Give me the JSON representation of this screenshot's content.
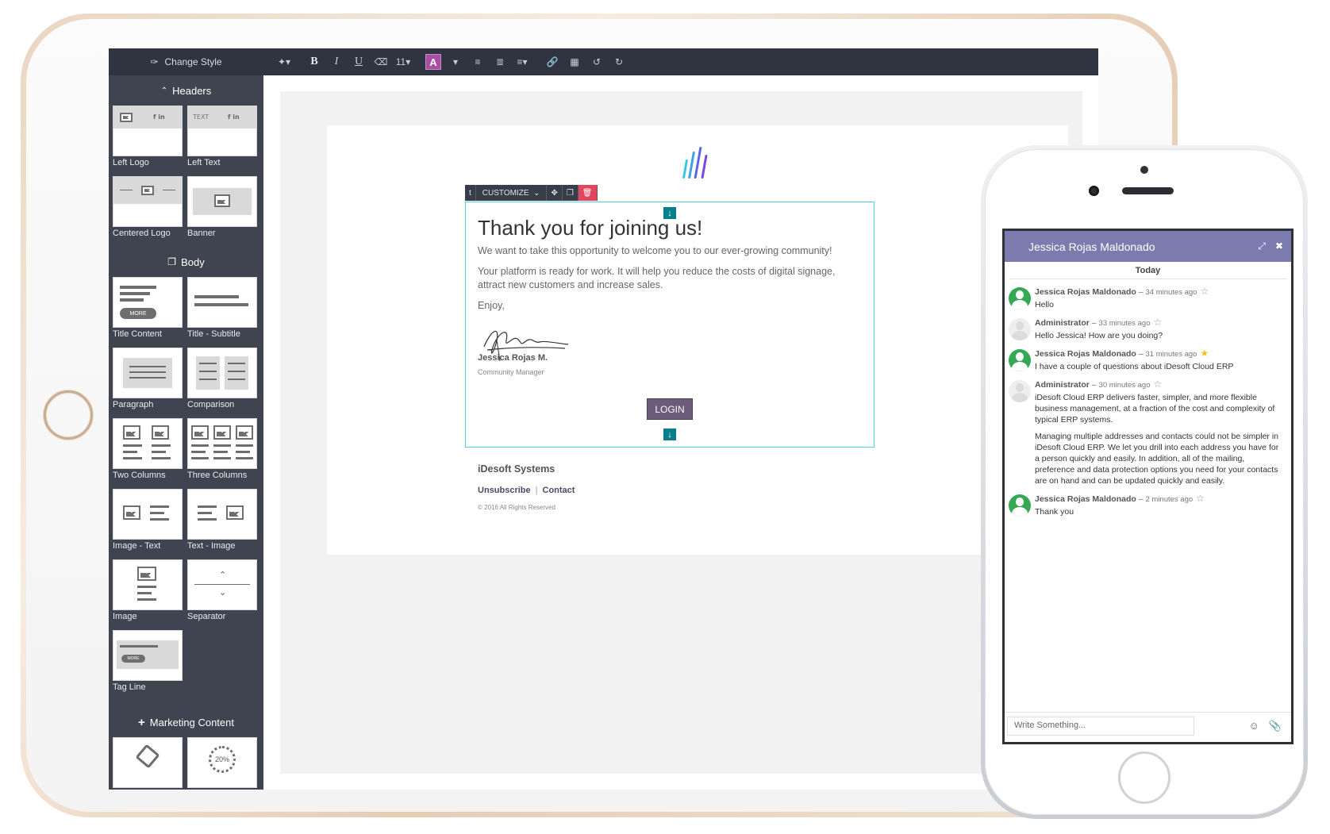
{
  "editor": {
    "change_style": "Change Style",
    "sections": {
      "headers": "Headers",
      "body": "Body",
      "marketing": "Marketing Content"
    },
    "header_tiles": [
      "Left Logo",
      "Left Text",
      "Centered Logo",
      "Banner"
    ],
    "body_tiles": [
      "Title Content",
      "Title - Subtitle",
      "Paragraph",
      "Comparison",
      "Two Columns",
      "Three Columns",
      "Image - Text",
      "Text - Image",
      "Image",
      "Separator",
      "Tag Line"
    ],
    "tile_text": {
      "text": "TEXT",
      "social": "f in ",
      "more": "MORE",
      "percent": "20%"
    },
    "toolbar": {
      "font_size": "11",
      "color_letter": "A"
    }
  },
  "email": {
    "customize_label": "CUSTOMIZE",
    "title": "Thank you for joining us!",
    "p1": "We want to take this opportunity to welcome you to our ever-growing community!",
    "p2": "Your platform is ready for work. It will help you reduce the costs of digital signage, attract new customers and increase sales.",
    "p3": "Enjoy,",
    "sig_name": "Jessica Rojas M.",
    "sig_role": "Community Manager",
    "login": "LOGIN",
    "company": "iDesoft Systems",
    "unsubscribe": "Unsubscribe",
    "contact": "Contact",
    "copyright": "© 2016 All Rights Reserved",
    "logo_colors": [
      "#36c6e0",
      "#3aa1e6",
      "#5a63e4",
      "#7a45e2"
    ]
  },
  "chat": {
    "name": "Jessica Rojas Maldonado",
    "today": "Today",
    "messages": [
      {
        "author": "Jessica Rojas Maldonado",
        "time": "34 minutes ago",
        "text": [
          "Hello"
        ]
      },
      {
        "author": "Administrator",
        "time": "33 minutes ago",
        "text": [
          "Hello Jessica! How are you doing?"
        ]
      },
      {
        "author": "Jessica Rojas Maldonado",
        "time": "31 minutes ago",
        "text": [
          "I have a couple of questions about iDesoft Cloud ERP"
        ]
      },
      {
        "author": "Administrator",
        "time": "30 minutes ago",
        "text": [
          "iDesoft Cloud ERP delivers faster, simpler, and more flexible business management, at a fraction of the cost and complexity of typical ERP systems.",
          "Managing multiple addresses and contacts could not be simpler in iDesoft Cloud ERP. We let you drill into each address you have for a person quickly and easily. In addition, all of the mailing, preference and data protection options you need for your contacts are on hand and can be updated quickly and easily."
        ]
      },
      {
        "author": "Jessica Rojas Maldonado",
        "time": "2 minutes ago",
        "text": [
          "Thank you"
        ]
      }
    ],
    "input_placeholder": "Write Something..."
  }
}
